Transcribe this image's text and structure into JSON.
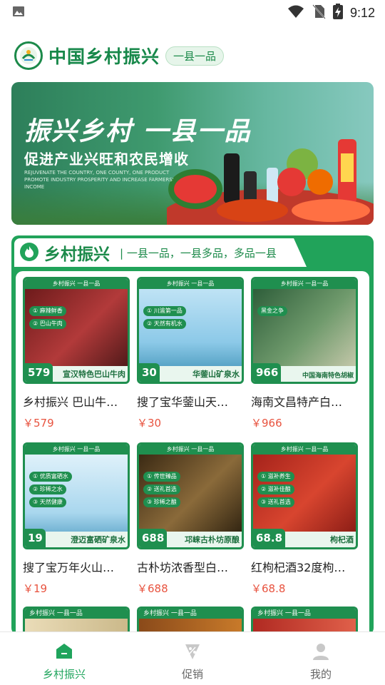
{
  "status_bar": {
    "time": "9:12"
  },
  "header": {
    "title": "中国乡村振兴",
    "tag": "一县一品"
  },
  "banner": {
    "title": "振兴乡村 一县一品",
    "subtitle": "促进产业兴旺和农民增收",
    "english": "REJUVENATE THE COUNTRY, ONE COUNTY, ONE PRODUCT PROMOTE INDUSTRY PROSPERITY AND INCREASE FARMERS' INCOME"
  },
  "section": {
    "title": "乡村振兴",
    "subtitle": "| 一县一品，一县多品，多品一县"
  },
  "products": [
    {
      "name": "乡村振兴 巴山牛…",
      "price": "￥579",
      "badge": "579",
      "label": "宣汉特色巴山牛肉"
    },
    {
      "name": "搜了宝华蓥山天…",
      "price": "￥30",
      "badge": "30",
      "label": "华蓥山矿泉水"
    },
    {
      "name": "海南文昌特产白…",
      "price": "￥966",
      "badge": "966",
      "label": "中国海南特色胡椒"
    },
    {
      "name": "搜了宝万年火山…",
      "price": "￥19",
      "badge": "19",
      "label": "澄迈富硒矿泉水"
    },
    {
      "name": "古朴坊浓香型白…",
      "price": "￥688",
      "badge": "688",
      "label": "邛崃古朴坊原酿"
    },
    {
      "name": "红枸杞酒32度枸…",
      "price": "￥68.8",
      "badge": "68.8",
      "label": "枸杞酒"
    }
  ],
  "card_strip": "乡村振兴 一县一品",
  "peek_strip": "乡村振兴 一县一品",
  "tabs": [
    {
      "label": "乡村振兴",
      "icon": "home-icon",
      "active": true
    },
    {
      "label": "促销",
      "icon": "promotion-icon",
      "active": false
    },
    {
      "label": "我的",
      "icon": "user-icon",
      "active": false
    }
  ],
  "colors": {
    "primary": "#1fa45c",
    "price": "#e8533f"
  }
}
